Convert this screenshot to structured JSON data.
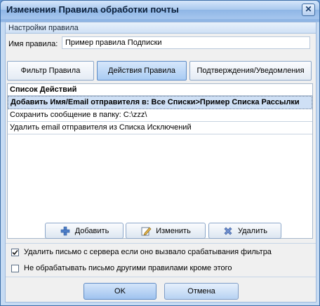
{
  "window": {
    "title": "Изменения Правила обработки почты"
  },
  "settings": {
    "group_title": "Настройки правила",
    "name_label": "Имя правила:",
    "name_value": "Пример правила Подписки"
  },
  "tabs": [
    {
      "label": "Фильтр Правила",
      "active": false
    },
    {
      "label": "Действия Правила",
      "active": true
    },
    {
      "label": "Подтверждения/Уведомления",
      "active": false
    }
  ],
  "actions": {
    "header": "Список Действий",
    "items": [
      {
        "text": "Добавить Имя/Email отправителя в: Все Списки>Пример Списка Рассылки",
        "selected": true
      },
      {
        "text": "Сохранить сообщение в папку: C:\\zzz\\",
        "selected": false
      },
      {
        "text": "Удалить email отправителя из Списка Исключений",
        "selected": false
      }
    ]
  },
  "buttons": {
    "add": "Добавить",
    "edit": "Изменить",
    "delete": "Удалить"
  },
  "options": {
    "delete_from_server": {
      "label": "Удалить письмо с сервера если оно вызвало срабатывания фильтра",
      "checked": true
    },
    "stop_processing": {
      "label": "Не обрабатывать письмо другими правилами кроме этого",
      "checked": false
    }
  },
  "dialog": {
    "ok": "OK",
    "cancel": "Отмена"
  },
  "icons": {
    "add": "plus-icon",
    "edit": "edit-icon",
    "delete": "cross-icon",
    "close": "close-icon"
  }
}
